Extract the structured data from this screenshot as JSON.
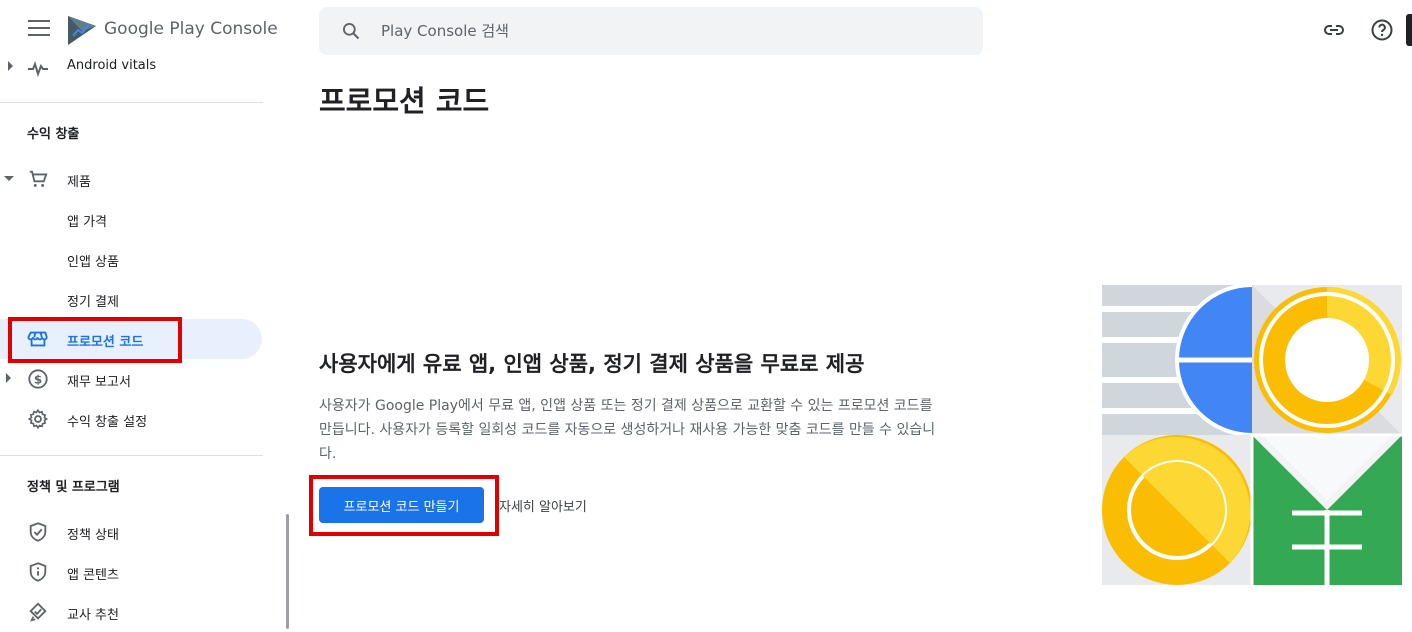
{
  "app": {
    "brand": "Google Play",
    "product": "Console"
  },
  "search": {
    "placeholder": "Play Console 검색"
  },
  "sidebar": {
    "partial_item": "Android vitals",
    "section_monetize": "수익 창출",
    "products": "제품",
    "app_price": "앱 가격",
    "in_app": "인앱 상품",
    "subscriptions": "정기 결제",
    "promo_codes": "프로모션 코드",
    "financial_reports": "재무 보고서",
    "monetize_settings": "수익 창출 설정",
    "section_policy": "정책 및 프로그램",
    "policy_status": "정책 상태",
    "app_content": "앱 콘텐츠",
    "teacher_approved": "교사 추천"
  },
  "main": {
    "title": "프로모션 코드",
    "hero_heading": "사용자에게 유료 앱, 인앱 상품, 정기 결제 상품을 무료로 제공",
    "hero_desc": "사용자가 Google Play에서 무료 앱, 인앱 상품 또는 정기 결제 상품으로 교환할 수 있는 프로모션 코드를 만듭니다. 사용자가 등록할 일회성 코드를 자동으로 생성하거나 재사용 가능한 맞춤 코드를 만들 수 있습니다.",
    "create_button": "프로모션 코드 만들기",
    "learn_more": "자세히 알아보기"
  },
  "colors": {
    "accent": "#1a73e8",
    "active_bg": "#e8f0fe",
    "highlight_box": "#e00000"
  }
}
